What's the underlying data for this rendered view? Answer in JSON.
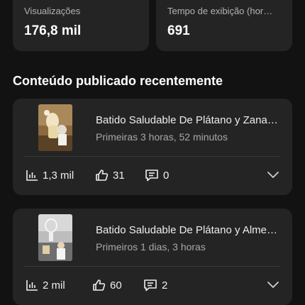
{
  "stats": [
    {
      "label": "Visualizações",
      "value": "176,8 mil"
    },
    {
      "label": "Tempo de exibição (hor…",
      "value": "691"
    }
  ],
  "section_title": "Conteúdo publicado recentemente",
  "videos": [
    {
      "title": "Batido Saludable De Plátano y Zana…",
      "subtitle": "Primeiras 3 horas, 52 minutos",
      "views": "1,3 mil",
      "likes": "31",
      "comments": "0"
    },
    {
      "title": "Batido Saludable De Plátano y Alme…",
      "subtitle": "Primeiros 1 dias, 3 horas",
      "views": "2 mil",
      "likes": "60",
      "comments": "2"
    }
  ],
  "icons": {
    "views": "bar-chart-icon",
    "likes": "thumbs-up-icon",
    "comments": "comment-icon",
    "expand": "chevron-down-icon"
  },
  "colors": {
    "background": "#121212",
    "card": "#242424",
    "text": "#ffffff",
    "muted": "#a8a8a8"
  }
}
